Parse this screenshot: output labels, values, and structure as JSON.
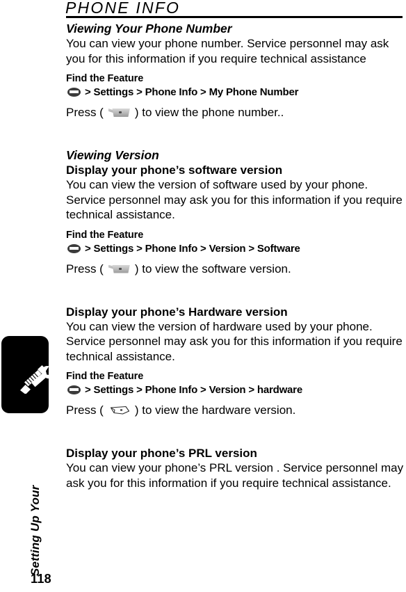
{
  "header": {
    "title": "PHONE INFO"
  },
  "chapter_label": "Setting Up Your",
  "page_number": "118",
  "icons": {
    "menu": "menu-key-icon",
    "softkey": "soft-key-icon",
    "hardware_key": "hardware-key-icon",
    "tools": "screwdriver-wrench-icon"
  },
  "sections": [
    {
      "heading_italic": "Viewing Your Phone Number",
      "body": "You can view your phone number. Service personnel may ask you for this information if you require technical assistance",
      "find_label": "Find the Feature",
      "path": "> Settings > Phone Info > My Phone Number",
      "press_lead": "Press (",
      "press_tail": ") to view the phone number.."
    },
    {
      "heading_italic": "Viewing Version",
      "heading_bold": "Display your phone’s software version",
      "body": "You can view the version of software used by your phone. Service personnel may ask you for this information if you require technical assistance.",
      "find_label": "Find the Feature",
      "path": "> Settings > Phone Info > Version > Software",
      "press_lead": "Press (",
      "press_tail": ") to view the software version."
    },
    {
      "heading_bold": "Display your phone’s Hardware version",
      "body": "You can view the version of hardware used by your phone. Service personnel may ask you for this information if you require technical assistance.",
      "find_label": "Find the Feature",
      "path": "> Settings > Phone Info > Version > hardware",
      "press_lead": "Press (",
      "press_tail": ") to view the hardware version."
    },
    {
      "heading_bold": "Display your phone’s PRL version",
      "body": "You can view your phone’s PRL version . Service personnel may ask you for this information if you require technical assistance."
    }
  ]
}
